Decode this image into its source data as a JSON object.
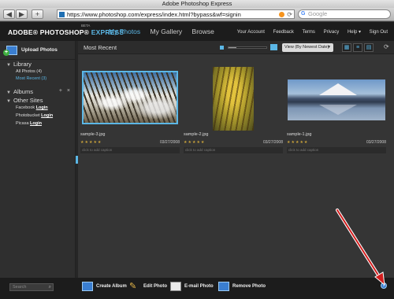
{
  "window": {
    "title": "Adobe Photoshop Express"
  },
  "browser": {
    "back_icon": "◀",
    "forward_icon": "▶",
    "add_icon": "+",
    "url": "https://www.photoshop.com/express/index.html?bypass&wf=signin",
    "search_placeholder": "Google",
    "google_glyph": "G"
  },
  "header": {
    "logo_main": "ADOBE® PHOTOSHOP®",
    "logo_express": "EXPRESS",
    "beta": "BETA",
    "nav": [
      "My Photos",
      "My Gallery",
      "Browse"
    ],
    "links": [
      "Your Account",
      "Feedback",
      "Terms",
      "Privacy",
      "Help ▾",
      "Sign Out"
    ]
  },
  "sidebar": {
    "upload_label": "Upload Photos",
    "library_title": "Library",
    "library_items": [
      "All Photos (4)",
      "Most Recent (3)"
    ],
    "albums_title": "Albums",
    "album_controls": [
      "+",
      "×"
    ],
    "other_title": "Other Sites",
    "sites": [
      {
        "name": "Facebook",
        "action": "Login"
      },
      {
        "name": "Photobucket",
        "action": "Login"
      },
      {
        "name": "Picasa",
        "action": "Login"
      }
    ]
  },
  "main": {
    "title": "Most Recent",
    "view_select": "View (By Newest Date)",
    "thumbnail_size": 0.2,
    "photos": [
      {
        "name": "sample-3.jpg",
        "date": "03/27/2008",
        "stars": "★★★★★",
        "caption": "click to add caption"
      },
      {
        "name": "sample-2.jpg",
        "date": "03/27/2008",
        "stars": "★★★★★",
        "caption": "click to add caption"
      },
      {
        "name": "sample-1.jpg",
        "date": "03/27/2008",
        "stars": "★★★★★",
        "caption": "click to add caption"
      }
    ]
  },
  "bottom": {
    "search_placeholder": "Search",
    "actions": [
      "Create Album",
      "Edit Photo",
      "E-mail Photo",
      "Remove Photo"
    ],
    "help": "?"
  },
  "icons": {
    "back": "back-arrow-icon",
    "forward": "forward-arrow-icon",
    "rss": "rss-icon",
    "reload": "reload-icon",
    "upload": "upload-photos-icon",
    "create_album": "create-album-icon",
    "edit": "pencil-icon",
    "email": "email-icon",
    "remove": "remove-photo-icon",
    "help": "help-icon",
    "refresh": "refresh-icon"
  },
  "colors": {
    "accent": "#5bb7e6",
    "bg": "#353535",
    "header": "#1c1c1c",
    "stars": "#c9a23b"
  }
}
